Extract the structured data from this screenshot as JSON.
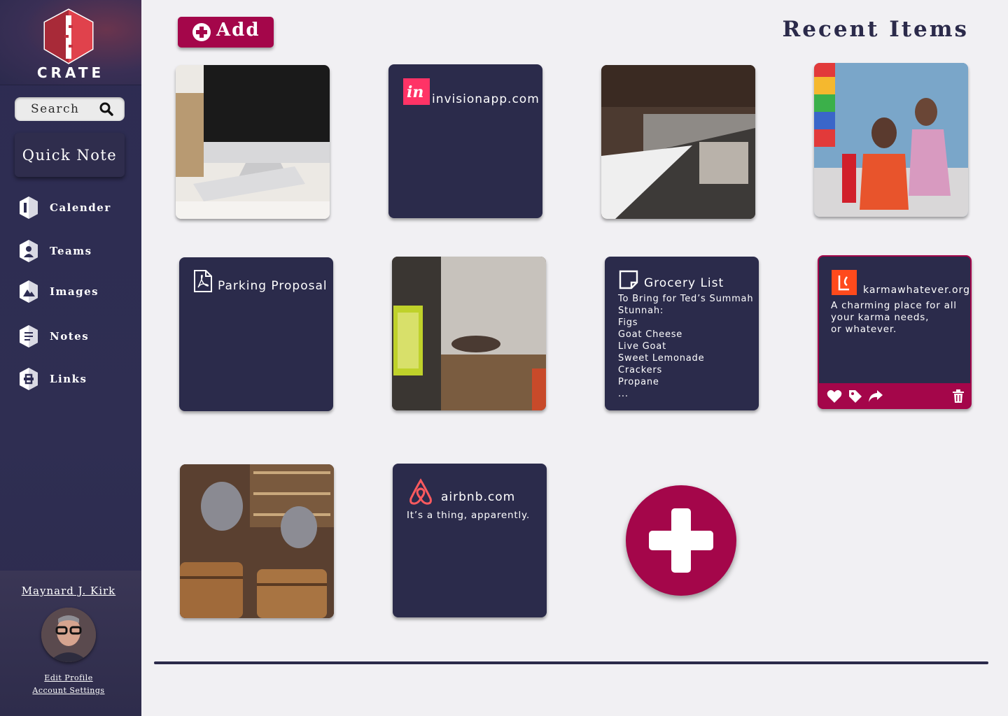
{
  "sidebar": {
    "brand": "CRATE",
    "search_placeholder": "Search",
    "quick_note_label": "Quick Note",
    "nav": [
      {
        "label": "Calender",
        "icon": "calendar-icon"
      },
      {
        "label": "Teams",
        "icon": "teams-icon"
      },
      {
        "label": "Images",
        "icon": "images-icon"
      },
      {
        "label": "Notes",
        "icon": "notes-icon"
      },
      {
        "label": "Links",
        "icon": "links-icon"
      }
    ],
    "profile": {
      "name": "Maynard J. Kirk",
      "edit_profile": "Edit Profile",
      "account_settings": "Account Settings"
    }
  },
  "header": {
    "add_label": "Add",
    "title": "Recent Items"
  },
  "cards": {
    "invision": {
      "title": "invisionapp.com"
    },
    "parking": {
      "title": "Parking Proposal"
    },
    "grocery": {
      "title": "Grocery List",
      "lines": [
        "To Bring for Ted’s Summah",
        "Stunnah:",
        "Figs",
        "Goat Cheese",
        "Live Goat",
        "Sweet Lemonade",
        "Crackers",
        "Propane",
        "..."
      ]
    },
    "karma": {
      "title": "karmawhatever.org",
      "description_lines": [
        "A charming place for all",
        "your karma needs,",
        "or whatever."
      ]
    },
    "airbnb": {
      "title": "airbnb.com",
      "description": "It’s a thing, apparently."
    }
  },
  "colors": {
    "sidebar": "#2d2c52",
    "card": "#2b2b4b",
    "accent": "#a4064a",
    "background": "#f1f0f3"
  }
}
